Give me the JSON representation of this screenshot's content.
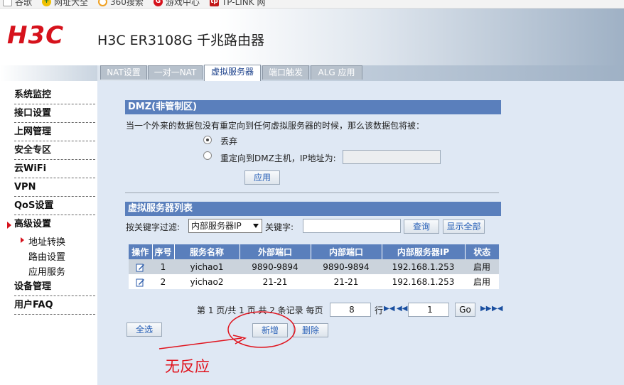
{
  "bookmarks": [
    {
      "label": "谷歌",
      "icon": "page-icon",
      "color": "#888888"
    },
    {
      "label": "网址大全",
      "icon": "plus-badge-icon",
      "color": "#2a7a2a"
    },
    {
      "label": "360搜索",
      "icon": "ring-icon",
      "color": "#f0a020"
    },
    {
      "label": "游戏中心",
      "icon": "game-icon",
      "color": "#d6121c"
    },
    {
      "label": "TP-LINK 网",
      "icon": "tplink-icon",
      "color": "#c21818"
    }
  ],
  "header": {
    "logo": "H3C",
    "title": "H3C ER3108G 千兆路由器"
  },
  "sidebar": {
    "items": [
      {
        "label": "系统监控"
      },
      {
        "label": "接口设置"
      },
      {
        "label": "上网管理"
      },
      {
        "label": "安全专区"
      },
      {
        "label": "云WiFi"
      },
      {
        "label": "VPN"
      },
      {
        "label": "QoS设置"
      },
      {
        "label": "高级设置"
      },
      {
        "label": "设备管理"
      },
      {
        "label": "用户FAQ"
      }
    ],
    "sub_items": [
      {
        "label": "地址转换"
      },
      {
        "label": "路由设置"
      },
      {
        "label": "应用服务"
      }
    ]
  },
  "tabs": [
    {
      "label": "NAT设置"
    },
    {
      "label": "一对一NAT"
    },
    {
      "label": "虚拟服务器"
    },
    {
      "label": "端口触发"
    },
    {
      "label": "ALG 应用"
    }
  ],
  "dmz": {
    "title": "DMZ(非管制区)",
    "description": "当一个外来的数据包没有重定向到任何虚拟服务器的时候，那么该数据包将被：",
    "option_discard": "丢弃",
    "option_redirect": "重定向到DMZ主机，IP地址为:",
    "ip_value": "",
    "apply_label": "应用"
  },
  "vs_list": {
    "title": "虚拟服务器列表",
    "filter_label": "按关键字过滤:",
    "filter_select": "内部服务器IP",
    "keyword_label": "关键字:",
    "keyword_value": "",
    "search_label": "查询",
    "show_all_label": "显示全部",
    "columns": [
      "操作",
      "序号",
      "服务名称",
      "外部端口",
      "内部端口",
      "内部服务器IP",
      "状态"
    ],
    "rows": [
      {
        "no": "1",
        "name": "yichao1",
        "ext_port": "9890-9894",
        "int_port": "9890-9894",
        "ip": "192.168.1.253",
        "status": "启用"
      },
      {
        "no": "2",
        "name": "yichao2",
        "ext_port": "21-21",
        "int_port": "21-21",
        "ip": "192.168.1.253",
        "status": "启用"
      }
    ]
  },
  "pager": {
    "summary": "第 1 页/共 1 页 共 2 条记录 每页",
    "per_page": "8",
    "row_label": "行",
    "page_value": "1",
    "go_label": "Go"
  },
  "actions": {
    "select_all": "全选",
    "add": "新增",
    "delete": "删除"
  },
  "annotation": "无反应",
  "colors": {
    "brand_red": "#d6121c",
    "section_blue": "#5a7fbc",
    "panel_bg": "#dfe8f4",
    "annotation_red": "#e0141e"
  }
}
